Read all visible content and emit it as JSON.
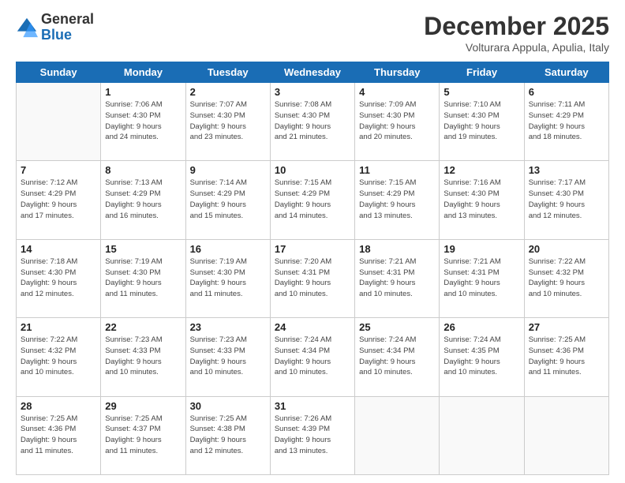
{
  "logo": {
    "general": "General",
    "blue": "Blue"
  },
  "title": "December 2025",
  "subtitle": "Volturara Appula, Apulia, Italy",
  "days_of_week": [
    "Sunday",
    "Monday",
    "Tuesday",
    "Wednesday",
    "Thursday",
    "Friday",
    "Saturday"
  ],
  "weeks": [
    [
      {
        "day": "",
        "info": ""
      },
      {
        "day": "1",
        "info": "Sunrise: 7:06 AM\nSunset: 4:30 PM\nDaylight: 9 hours\nand 24 minutes."
      },
      {
        "day": "2",
        "info": "Sunrise: 7:07 AM\nSunset: 4:30 PM\nDaylight: 9 hours\nand 23 minutes."
      },
      {
        "day": "3",
        "info": "Sunrise: 7:08 AM\nSunset: 4:30 PM\nDaylight: 9 hours\nand 21 minutes."
      },
      {
        "day": "4",
        "info": "Sunrise: 7:09 AM\nSunset: 4:30 PM\nDaylight: 9 hours\nand 20 minutes."
      },
      {
        "day": "5",
        "info": "Sunrise: 7:10 AM\nSunset: 4:30 PM\nDaylight: 9 hours\nand 19 minutes."
      },
      {
        "day": "6",
        "info": "Sunrise: 7:11 AM\nSunset: 4:29 PM\nDaylight: 9 hours\nand 18 minutes."
      }
    ],
    [
      {
        "day": "7",
        "info": "Sunrise: 7:12 AM\nSunset: 4:29 PM\nDaylight: 9 hours\nand 17 minutes."
      },
      {
        "day": "8",
        "info": "Sunrise: 7:13 AM\nSunset: 4:29 PM\nDaylight: 9 hours\nand 16 minutes."
      },
      {
        "day": "9",
        "info": "Sunrise: 7:14 AM\nSunset: 4:29 PM\nDaylight: 9 hours\nand 15 minutes."
      },
      {
        "day": "10",
        "info": "Sunrise: 7:15 AM\nSunset: 4:29 PM\nDaylight: 9 hours\nand 14 minutes."
      },
      {
        "day": "11",
        "info": "Sunrise: 7:15 AM\nSunset: 4:29 PM\nDaylight: 9 hours\nand 13 minutes."
      },
      {
        "day": "12",
        "info": "Sunrise: 7:16 AM\nSunset: 4:30 PM\nDaylight: 9 hours\nand 13 minutes."
      },
      {
        "day": "13",
        "info": "Sunrise: 7:17 AM\nSunset: 4:30 PM\nDaylight: 9 hours\nand 12 minutes."
      }
    ],
    [
      {
        "day": "14",
        "info": "Sunrise: 7:18 AM\nSunset: 4:30 PM\nDaylight: 9 hours\nand 12 minutes."
      },
      {
        "day": "15",
        "info": "Sunrise: 7:19 AM\nSunset: 4:30 PM\nDaylight: 9 hours\nand 11 minutes."
      },
      {
        "day": "16",
        "info": "Sunrise: 7:19 AM\nSunset: 4:30 PM\nDaylight: 9 hours\nand 11 minutes."
      },
      {
        "day": "17",
        "info": "Sunrise: 7:20 AM\nSunset: 4:31 PM\nDaylight: 9 hours\nand 10 minutes."
      },
      {
        "day": "18",
        "info": "Sunrise: 7:21 AM\nSunset: 4:31 PM\nDaylight: 9 hours\nand 10 minutes."
      },
      {
        "day": "19",
        "info": "Sunrise: 7:21 AM\nSunset: 4:31 PM\nDaylight: 9 hours\nand 10 minutes."
      },
      {
        "day": "20",
        "info": "Sunrise: 7:22 AM\nSunset: 4:32 PM\nDaylight: 9 hours\nand 10 minutes."
      }
    ],
    [
      {
        "day": "21",
        "info": "Sunrise: 7:22 AM\nSunset: 4:32 PM\nDaylight: 9 hours\nand 10 minutes."
      },
      {
        "day": "22",
        "info": "Sunrise: 7:23 AM\nSunset: 4:33 PM\nDaylight: 9 hours\nand 10 minutes."
      },
      {
        "day": "23",
        "info": "Sunrise: 7:23 AM\nSunset: 4:33 PM\nDaylight: 9 hours\nand 10 minutes."
      },
      {
        "day": "24",
        "info": "Sunrise: 7:24 AM\nSunset: 4:34 PM\nDaylight: 9 hours\nand 10 minutes."
      },
      {
        "day": "25",
        "info": "Sunrise: 7:24 AM\nSunset: 4:34 PM\nDaylight: 9 hours\nand 10 minutes."
      },
      {
        "day": "26",
        "info": "Sunrise: 7:24 AM\nSunset: 4:35 PM\nDaylight: 9 hours\nand 10 minutes."
      },
      {
        "day": "27",
        "info": "Sunrise: 7:25 AM\nSunset: 4:36 PM\nDaylight: 9 hours\nand 11 minutes."
      }
    ],
    [
      {
        "day": "28",
        "info": "Sunrise: 7:25 AM\nSunset: 4:36 PM\nDaylight: 9 hours\nand 11 minutes."
      },
      {
        "day": "29",
        "info": "Sunrise: 7:25 AM\nSunset: 4:37 PM\nDaylight: 9 hours\nand 11 minutes."
      },
      {
        "day": "30",
        "info": "Sunrise: 7:25 AM\nSunset: 4:38 PM\nDaylight: 9 hours\nand 12 minutes."
      },
      {
        "day": "31",
        "info": "Sunrise: 7:26 AM\nSunset: 4:39 PM\nDaylight: 9 hours\nand 13 minutes."
      },
      {
        "day": "",
        "info": ""
      },
      {
        "day": "",
        "info": ""
      },
      {
        "day": "",
        "info": ""
      }
    ]
  ]
}
